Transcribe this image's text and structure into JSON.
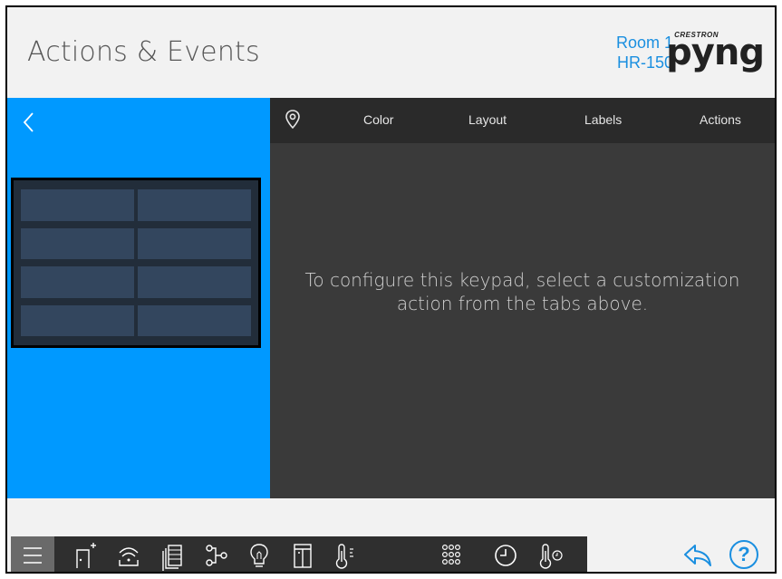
{
  "header": {
    "title": "Actions & Events",
    "room_name": "Room 1",
    "device_name": "HR-150",
    "logo_brand": "CRESTRON",
    "logo_text": "pyng"
  },
  "tabs": {
    "items": [
      {
        "icon": "location-pin-icon"
      },
      {
        "label": "Color"
      },
      {
        "label": "Layout"
      },
      {
        "label": "Labels"
      },
      {
        "label": "Actions"
      }
    ]
  },
  "content": {
    "message": "To configure this keypad, select a customization action from the tabs above."
  },
  "keypad": {
    "button_count": 8
  },
  "nav": {
    "icons": [
      "menu-icon",
      "add-room-icon",
      "wireless-device-icon",
      "shades-icon",
      "scene-icon",
      "light-bulb-icon",
      "keypad-door-icon",
      "thermostat-icon",
      "keypad-icon",
      "clock-icon",
      "temperature-sensor-icon"
    ],
    "active": "keypad-icon",
    "right_icons": [
      "share-icon",
      "help-icon"
    ],
    "help_label": "?"
  },
  "colors": {
    "accent": "#0099ff",
    "brand_blue": "#1a8fe0",
    "dark_panel": "#3a3a3a",
    "tab_bar": "#2a2a2a",
    "keypad_bg": "#222d3a",
    "keypad_button": "#33465e"
  }
}
